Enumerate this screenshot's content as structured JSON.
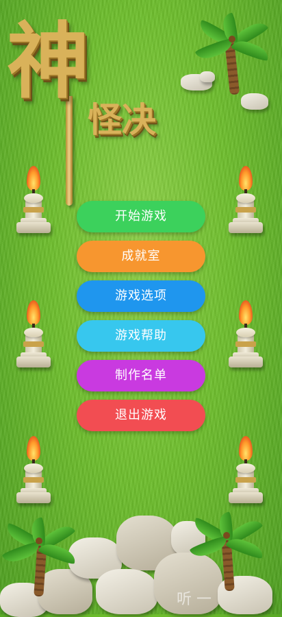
{
  "title": {
    "main_char": "神",
    "sub_chars": "怪决"
  },
  "menu": {
    "items": [
      {
        "label": "开始游戏",
        "color": "#3cd15c"
      },
      {
        "label": "成就室",
        "color": "#f7962f"
      },
      {
        "label": "游戏选项",
        "color": "#1f96ee"
      },
      {
        "label": "游戏帮助",
        "color": "#37c7ee"
      },
      {
        "label": "制作名单",
        "color": "#c93ae0"
      },
      {
        "label": "退出游戏",
        "color": "#f24d52"
      }
    ]
  },
  "watermark": "听  一"
}
